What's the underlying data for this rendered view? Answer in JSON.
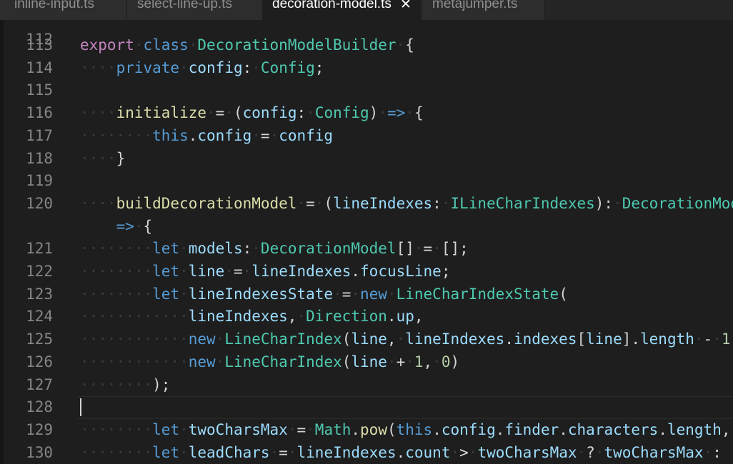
{
  "tabs": [
    {
      "label": "inline-input.ts",
      "active": false
    },
    {
      "label": "select-line-up.ts",
      "active": false
    },
    {
      "label": "decoration-model.ts",
      "active": true,
      "close": "✕"
    },
    {
      "label": "metajumper.ts",
      "active": false
    }
  ],
  "editor": {
    "partial_top_line_number": "112",
    "lines": [
      {
        "n": "113",
        "tokens": [
          [
            "kw2",
            "export"
          ],
          [
            "ws",
            "·"
          ],
          [
            "kw",
            "class"
          ],
          [
            "ws",
            "·"
          ],
          [
            "ty",
            "DecorationModelBuilder"
          ],
          [
            "ws",
            "·"
          ],
          [
            "p",
            "{"
          ]
        ]
      },
      {
        "n": "114",
        "tokens": [
          [
            "ws",
            "····"
          ],
          [
            "kw",
            "private"
          ],
          [
            "ws",
            "·"
          ],
          [
            "var",
            "config"
          ],
          [
            "p",
            ":"
          ],
          [
            "ws",
            "·"
          ],
          [
            "ty",
            "Config"
          ],
          [
            "p",
            ";"
          ]
        ]
      },
      {
        "n": "115",
        "tokens": []
      },
      {
        "n": "116",
        "tokens": [
          [
            "ws",
            "····"
          ],
          [
            "fn",
            "initialize"
          ],
          [
            "ws",
            "·"
          ],
          [
            "p",
            "="
          ],
          [
            "ws",
            "·"
          ],
          [
            "p",
            "("
          ],
          [
            "var",
            "config"
          ],
          [
            "p",
            ":"
          ],
          [
            "ws",
            "·"
          ],
          [
            "ty",
            "Config"
          ],
          [
            "p",
            ")"
          ],
          [
            "ws",
            "·"
          ],
          [
            "kw",
            "=>"
          ],
          [
            "ws",
            "·"
          ],
          [
            "p",
            "{"
          ]
        ]
      },
      {
        "n": "117",
        "tokens": [
          [
            "ws",
            "········"
          ],
          [
            "kw",
            "this"
          ],
          [
            "p",
            "."
          ],
          [
            "var",
            "config"
          ],
          [
            "ws",
            "·"
          ],
          [
            "p",
            "="
          ],
          [
            "ws",
            "·"
          ],
          [
            "var",
            "config"
          ]
        ]
      },
      {
        "n": "118",
        "tokens": [
          [
            "ws",
            "····"
          ],
          [
            "p",
            "}"
          ]
        ]
      },
      {
        "n": "119",
        "tokens": []
      },
      {
        "n": "120",
        "tokens": [
          [
            "ws",
            "····"
          ],
          [
            "fn",
            "buildDecorationModel"
          ],
          [
            "ws",
            "·"
          ],
          [
            "p",
            "="
          ],
          [
            "ws",
            "·"
          ],
          [
            "p",
            "("
          ],
          [
            "var",
            "lineIndexes"
          ],
          [
            "p",
            ":"
          ],
          [
            "ws",
            "·"
          ],
          [
            "ty",
            "ILineCharIndexes"
          ],
          [
            "p",
            "):"
          ],
          [
            "ws",
            "·"
          ],
          [
            "ty",
            "DecorationMod"
          ]
        ]
      },
      {
        "n": "",
        "tokens": [
          [
            "ws",
            "    "
          ],
          [
            "kw",
            "=>"
          ],
          [
            "ws",
            "·"
          ],
          [
            "p",
            "{"
          ]
        ]
      },
      {
        "n": "121",
        "tokens": [
          [
            "ws",
            "········"
          ],
          [
            "kw",
            "let"
          ],
          [
            "ws",
            "·"
          ],
          [
            "var",
            "models"
          ],
          [
            "p",
            ":"
          ],
          [
            "ws",
            "·"
          ],
          [
            "ty",
            "DecorationModel"
          ],
          [
            "p",
            "[]"
          ],
          [
            "ws",
            "·"
          ],
          [
            "p",
            "="
          ],
          [
            "ws",
            "·"
          ],
          [
            "p",
            "[];"
          ]
        ]
      },
      {
        "n": "122",
        "tokens": [
          [
            "ws",
            "········"
          ],
          [
            "kw",
            "let"
          ],
          [
            "ws",
            "·"
          ],
          [
            "var",
            "line"
          ],
          [
            "ws",
            "·"
          ],
          [
            "p",
            "="
          ],
          [
            "ws",
            "·"
          ],
          [
            "var",
            "lineIndexes"
          ],
          [
            "p",
            "."
          ],
          [
            "var",
            "focusLine"
          ],
          [
            "p",
            ";"
          ]
        ]
      },
      {
        "n": "123",
        "tokens": [
          [
            "ws",
            "········"
          ],
          [
            "kw",
            "let"
          ],
          [
            "ws",
            "·"
          ],
          [
            "var",
            "lineIndexesState"
          ],
          [
            "ws",
            "·"
          ],
          [
            "p",
            "="
          ],
          [
            "ws",
            "·"
          ],
          [
            "kw",
            "new"
          ],
          [
            "ws",
            "·"
          ],
          [
            "ty",
            "LineCharIndexState"
          ],
          [
            "p",
            "("
          ]
        ]
      },
      {
        "n": "124",
        "tokens": [
          [
            "ws",
            "············"
          ],
          [
            "var",
            "lineIndexes"
          ],
          [
            "p",
            ","
          ],
          [
            "ws",
            "·"
          ],
          [
            "ty",
            "Direction"
          ],
          [
            "p",
            "."
          ],
          [
            "var",
            "up"
          ],
          [
            "p",
            ","
          ]
        ]
      },
      {
        "n": "125",
        "tokens": [
          [
            "ws",
            "············"
          ],
          [
            "kw",
            "new"
          ],
          [
            "ws",
            "·"
          ],
          [
            "ty",
            "LineCharIndex"
          ],
          [
            "p",
            "("
          ],
          [
            "var",
            "line"
          ],
          [
            "p",
            ","
          ],
          [
            "ws",
            "·"
          ],
          [
            "var",
            "lineIndexes"
          ],
          [
            "p",
            "."
          ],
          [
            "var",
            "indexes"
          ],
          [
            "p",
            "["
          ],
          [
            "var",
            "line"
          ],
          [
            "p",
            "]."
          ],
          [
            "var",
            "length"
          ],
          [
            "ws",
            "·"
          ],
          [
            "p",
            "-"
          ],
          [
            "ws",
            "·"
          ],
          [
            "num",
            "1"
          ]
        ]
      },
      {
        "n": "126",
        "tokens": [
          [
            "ws",
            "············"
          ],
          [
            "kw",
            "new"
          ],
          [
            "ws",
            "·"
          ],
          [
            "ty",
            "LineCharIndex"
          ],
          [
            "p",
            "("
          ],
          [
            "var",
            "line"
          ],
          [
            "ws",
            "·"
          ],
          [
            "p",
            "+"
          ],
          [
            "ws",
            "·"
          ],
          [
            "num",
            "1"
          ],
          [
            "p",
            ","
          ],
          [
            "ws",
            "·"
          ],
          [
            "num",
            "0"
          ],
          [
            "p",
            ")"
          ]
        ]
      },
      {
        "n": "127",
        "tokens": [
          [
            "ws",
            "········"
          ],
          [
            "p",
            ");"
          ]
        ]
      },
      {
        "n": "128",
        "tokens": [],
        "current": true
      },
      {
        "n": "129",
        "tokens": [
          [
            "ws",
            "········"
          ],
          [
            "kw",
            "let"
          ],
          [
            "ws",
            "·"
          ],
          [
            "var",
            "twoCharsMax"
          ],
          [
            "ws",
            "·"
          ],
          [
            "p",
            "="
          ],
          [
            "ws",
            "·"
          ],
          [
            "ty",
            "Math"
          ],
          [
            "p",
            "."
          ],
          [
            "fn",
            "pow"
          ],
          [
            "p",
            "("
          ],
          [
            "kw",
            "this"
          ],
          [
            "p",
            "."
          ],
          [
            "var",
            "config"
          ],
          [
            "p",
            "."
          ],
          [
            "var",
            "finder"
          ],
          [
            "p",
            "."
          ],
          [
            "var",
            "characters"
          ],
          [
            "p",
            "."
          ],
          [
            "var",
            "length"
          ],
          [
            "p",
            ","
          ]
        ]
      },
      {
        "n": "130",
        "tokens": [
          [
            "ws",
            "········"
          ],
          [
            "kw",
            "let"
          ],
          [
            "ws",
            "·"
          ],
          [
            "var",
            "leadChars"
          ],
          [
            "ws",
            "·"
          ],
          [
            "p",
            "="
          ],
          [
            "ws",
            "·"
          ],
          [
            "var",
            "lineIndexes"
          ],
          [
            "p",
            "."
          ],
          [
            "var",
            "count"
          ],
          [
            "ws",
            "·"
          ],
          [
            "p",
            ">"
          ],
          [
            "ws",
            "·"
          ],
          [
            "var",
            "twoCharsMax"
          ],
          [
            "ws",
            "·"
          ],
          [
            "p",
            "?"
          ],
          [
            "ws",
            "·"
          ],
          [
            "var",
            "twoCharsMax"
          ],
          [
            "ws",
            "·"
          ],
          [
            "p",
            ":"
          ]
        ]
      }
    ]
  }
}
